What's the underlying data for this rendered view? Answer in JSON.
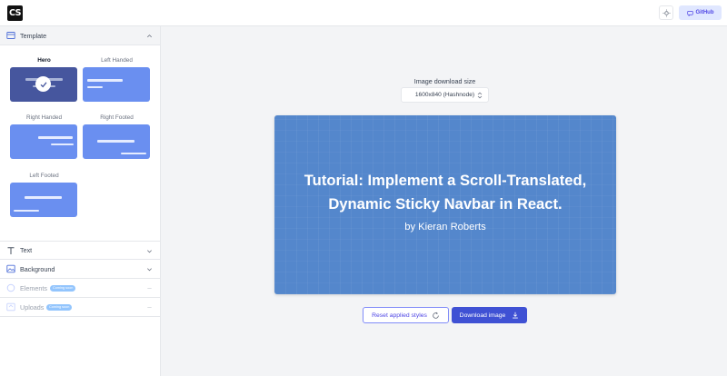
{
  "header": {
    "logo_text": "CS",
    "github_label": "GitHub"
  },
  "sidebar": {
    "template_section": {
      "label": "Template",
      "templates": [
        {
          "name": "Hero",
          "selected": true
        },
        {
          "name": "Left Handed",
          "selected": false
        },
        {
          "name": "Right Handed",
          "selected": false
        },
        {
          "name": "Right Footed",
          "selected": false
        },
        {
          "name": "Left Footed",
          "selected": false
        }
      ]
    },
    "sections": [
      {
        "label": "Text",
        "icon": "text-icon",
        "disabled": false
      },
      {
        "label": "Background",
        "icon": "image-icon",
        "disabled": false
      },
      {
        "label": "Elements",
        "icon": "circle-icon",
        "disabled": true,
        "badge": "Coming soon"
      },
      {
        "label": "Uploads",
        "icon": "upload-icon",
        "disabled": true,
        "badge": "Coming soon"
      }
    ]
  },
  "main": {
    "size_label": "Image download size",
    "size_value": "1600x840 (Hashnode)",
    "preview": {
      "title_line1": "Tutorial: Implement a Scroll-Translated,",
      "title_line2": "Dynamic Sticky Navbar in React.",
      "author": "by Kieran Roberts",
      "background_color": "#5487cc"
    },
    "reset_label": "Reset applied styles",
    "download_label": "Download image"
  },
  "colors": {
    "accent": "#3f51d4",
    "template_card": "#6a8ff0",
    "template_selected": "#46569e"
  }
}
